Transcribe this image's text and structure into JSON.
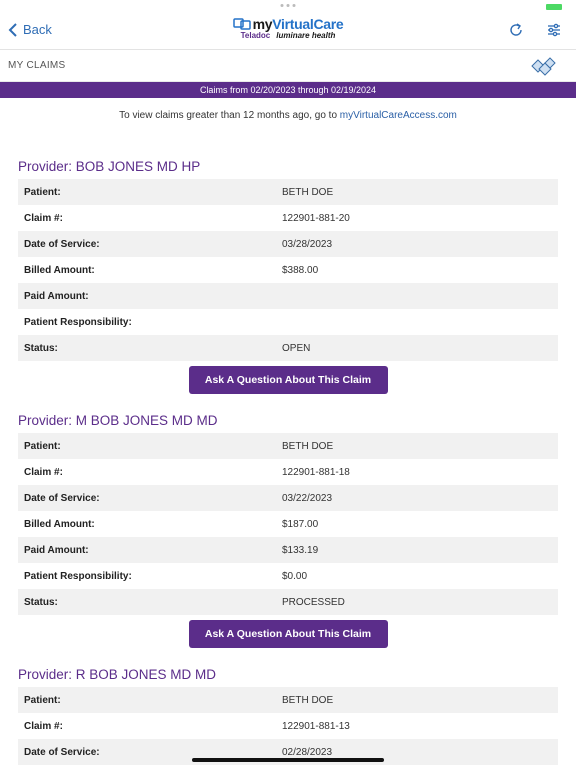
{
  "header": {
    "back_label": "Back",
    "logo_prefix": "my",
    "logo_brand": "VirtualCare",
    "logo_teladoc": "Teladoc",
    "logo_luminare": "luminare health"
  },
  "page": {
    "title": "MY CLAIMS",
    "date_range": "Claims from 02/20/2023 through 02/19/2024",
    "info_text": "To view claims greater than 12 months ago, go to ",
    "info_link": "myVirtualCareAccess.com"
  },
  "labels": {
    "patient": "Patient:",
    "claim": "Claim #:",
    "date": "Date of Service:",
    "billed": "Billed Amount:",
    "paid": "Paid Amount:",
    "responsibility": "Patient Responsibility:",
    "status": "Status:",
    "ask_button": "Ask A Question About This Claim"
  },
  "claims": [
    {
      "provider": "Provider: BOB JONES MD HP",
      "patient": "BETH DOE",
      "claim": "122901-881-20",
      "date": "03/28/2023",
      "billed": "$388.00",
      "paid": "",
      "responsibility": "",
      "status": "OPEN"
    },
    {
      "provider": "Provider: M BOB JONES MD MD",
      "patient": "BETH DOE",
      "claim": "122901-881-18",
      "date": "03/22/2023",
      "billed": "$187.00",
      "paid": "$133.19",
      "responsibility": "$0.00",
      "status": "PROCESSED"
    },
    {
      "provider": "Provider: R BOB JONES MD MD",
      "patient": "BETH DOE",
      "claim": "122901-881-13",
      "date": "02/28/2023"
    }
  ],
  "colors": {
    "brand_purple": "#5b2d8a",
    "link_blue": "#2a5fa6"
  }
}
